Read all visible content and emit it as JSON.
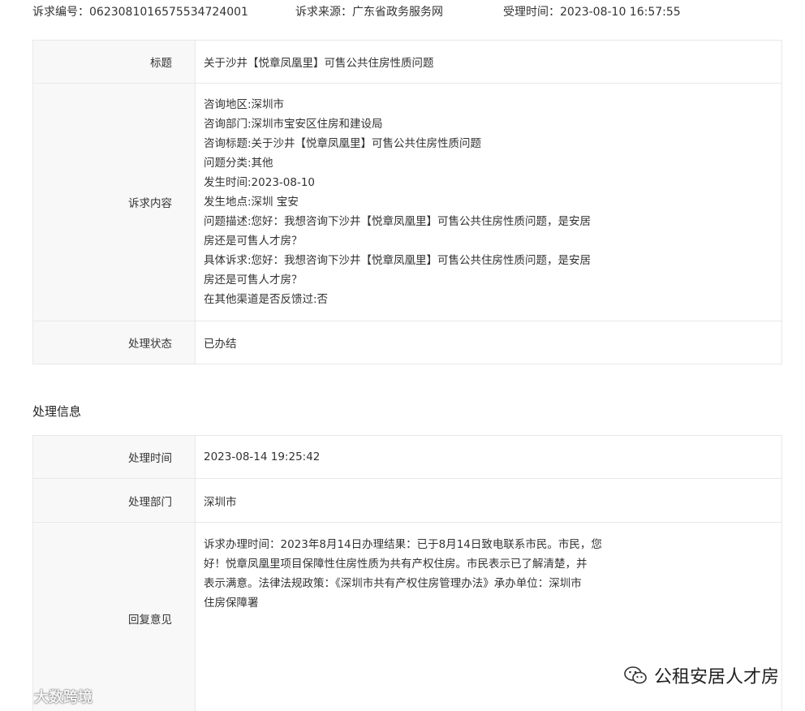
{
  "meta": {
    "complaint_no": "诉求编号：0623081016575534724001",
    "source": "诉求来源：广东省政务服务网",
    "accept_time": "受理时间：2023-08-10 16:57:55"
  },
  "request": {
    "title_label": "标题",
    "title_value": "关于沙井【悦章凤凰里】可售公共住房性质问题",
    "content_label": "诉求内容",
    "content_lines": [
      "咨询地区:深圳市",
      "咨询部门:深圳市宝安区住房和建设局",
      "咨询标题:关于沙井【悦章凤凰里】可售公共住房性质问题",
      "问题分类:其他",
      "发生时间:2023-08-10",
      "发生地点:深圳 宝安",
      "问题描述:您好：我想咨询下沙井【悦章凤凰里】可售公共住房性质问题，是安居",
      "房还是可售人才房？",
      "具体诉求:您好：我想咨询下沙井【悦章凤凰里】可售公共住房性质问题，是安居",
      "房还是可售人才房？",
      "在其他渠道是否反馈过:否"
    ],
    "status_label": "处理状态",
    "status_value": "已办结"
  },
  "section_title": "处理信息",
  "handling": {
    "time_label": "处理时间",
    "time_value": "2023-08-14 19:25:42",
    "dept_label": "处理部门",
    "dept_value": "深圳市",
    "reply_label": "回复意见",
    "reply_lines": [
      "诉求办理时间：2023年8月14日办理结果：已于8月14日致电联系市民。市民，您",
      "好！悦章凤凰里项目保障性住房性质为共有产权住房。市民表示已了解清楚，并",
      "表示满意。法律法规政策：《深圳市共有产权住房管理办法》承办单位：深圳市",
      "住房保障署"
    ]
  },
  "watermarks": {
    "left_text": "大数跨境",
    "right_text": "公租安居人才房"
  },
  "colors": {
    "status_done": "#52a339",
    "label_bg": "#f8f8f8",
    "border": "#e8e8e8"
  }
}
